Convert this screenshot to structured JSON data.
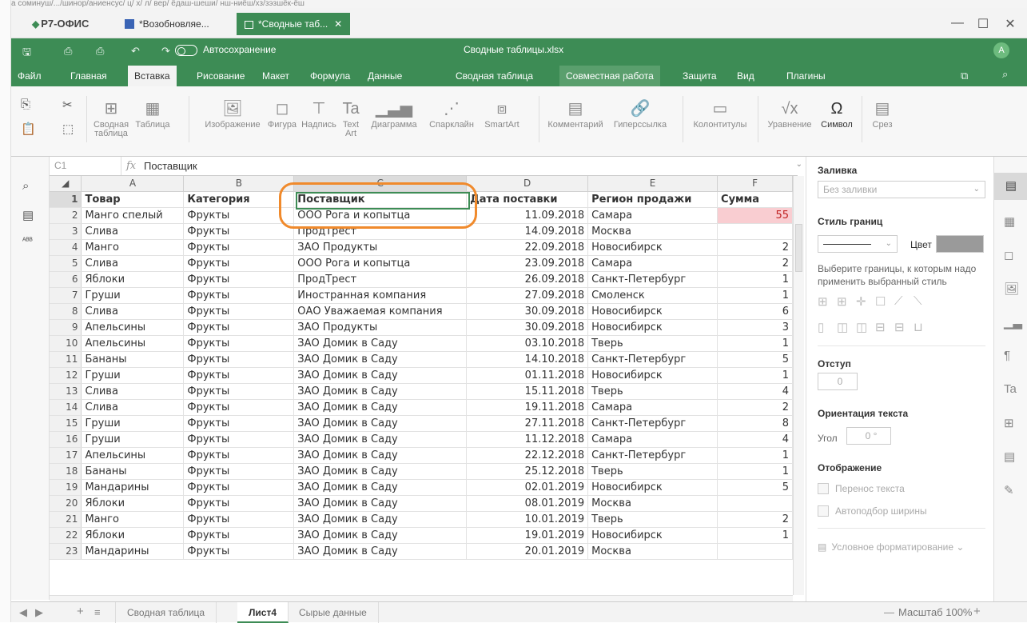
{
  "app": {
    "brand": "Р7-ОФИС",
    "tabs": [
      {
        "label": "*Возобновляе...",
        "active": false
      },
      {
        "label": "*Сводные таб...",
        "active": true
      }
    ],
    "url_strip": "а соминуш/.../шинор/аниенсус/ ц/ х/ л/ вер/ ёдаш-шеши/ нш-ниёш/хз/зэзшёк-ёш"
  },
  "header": {
    "autosave_label": "Автосохранение",
    "filename": "Сводные таблицы.xlsx",
    "avatar_initial": "A",
    "menu": [
      "Файл",
      "Главная",
      "Вставка",
      "Рисование",
      "Макет",
      "Формула",
      "Данные",
      "Сводная таблица",
      "Совместная работа",
      "Защита",
      "Вид",
      "Плагины"
    ],
    "active_menu": "Вставка",
    "highlight_menu": "Совместная работа"
  },
  "toolbar": {
    "pivot_label": "Сводная\nтаблица",
    "table_label": "Таблица",
    "image_label": "Изображение",
    "shape_label": "Фигура",
    "textbox_label": "Надпись",
    "textart_label": "Text\nArt",
    "chart_label": "Диаграмма",
    "sparkline_label": "Спарклайн",
    "smartart_label": "SmartArt",
    "comment_label": "Комментарий",
    "hyperlink_label": "Гиперссылка",
    "headerfooter_label": "Колонтитулы",
    "equation_label": "Уравнение",
    "symbol_label": "Символ",
    "slicer_label": "Срез"
  },
  "formula_bar": {
    "cell_ref": "C1",
    "fx": "fx",
    "value": "Поставщик"
  },
  "grid": {
    "columns": [
      "A",
      "B",
      "C",
      "D",
      "E",
      "F"
    ],
    "selected_column": "C",
    "header_row": [
      "Товар",
      "Категория",
      "Поставщик",
      "Дата поставки",
      "Регион продажи",
      "Сумма"
    ],
    "rows": [
      [
        "2",
        "Манго спелый",
        "Фрукты",
        "ООО Рога и копытца",
        "11.09.2018",
        "Самара",
        "55"
      ],
      [
        "3",
        "Слива",
        "Фрукты",
        "ПродТрест",
        "14.09.2018",
        "Москва",
        ""
      ],
      [
        "4",
        "Манго",
        "Фрукты",
        "ЗАО Продукты",
        "22.09.2018",
        "Новосибирск",
        "2"
      ],
      [
        "5",
        "Слива",
        "Фрукты",
        "ООО Рога и копытца",
        "23.09.2018",
        "Самара",
        "2"
      ],
      [
        "6",
        "Яблоки",
        "Фрукты",
        "ПродТрест",
        "26.09.2018",
        "Санкт-Петербург",
        "1"
      ],
      [
        "7",
        "Груши",
        "Фрукты",
        "Иностранная компания",
        "27.09.2018",
        "Смоленск",
        "1"
      ],
      [
        "8",
        "Слива",
        "Фрукты",
        "ОАО Уважаемая компания",
        "30.09.2018",
        "Новосибирск",
        "6"
      ],
      [
        "9",
        "Апельсины",
        "Фрукты",
        "ЗАО Продукты",
        "30.09.2018",
        "Новосибирск",
        "3"
      ],
      [
        "10",
        "Апельсины",
        "Фрукты",
        "ЗАО Домик в Саду",
        "03.10.2018",
        "Тверь",
        "1"
      ],
      [
        "11",
        "Бананы",
        "Фрукты",
        "ЗАО Домик в Саду",
        "14.10.2018",
        "Санкт-Петербург",
        "5"
      ],
      [
        "12",
        "Груши",
        "Фрукты",
        "ЗАО Домик в Саду",
        "01.11.2018",
        "Новосибирск",
        "1"
      ],
      [
        "13",
        "Слива",
        "Фрукты",
        "ЗАО Домик в Саду",
        "15.11.2018",
        "Тверь",
        "4"
      ],
      [
        "14",
        "Слива",
        "Фрукты",
        "ЗАО Домик в Саду",
        "19.11.2018",
        "Самара",
        "2"
      ],
      [
        "15",
        "Груши",
        "Фрукты",
        "ЗАО Домик в Саду",
        "27.11.2018",
        "Санкт-Петербург",
        "8"
      ],
      [
        "16",
        "Груши",
        "Фрукты",
        "ЗАО Домик в Саду",
        "11.12.2018",
        "Самара",
        "4"
      ],
      [
        "17",
        "Апельсины",
        "Фрукты",
        "ЗАО Домик в Саду",
        "22.12.2018",
        "Санкт-Петербург",
        "1"
      ],
      [
        "18",
        "Бананы",
        "Фрукты",
        "ЗАО Домик в Саду",
        "25.12.2018",
        "Тверь",
        "1"
      ],
      [
        "19",
        "Мандарины",
        "Фрукты",
        "ЗАО Домик в Саду",
        "02.01.2019",
        "Новосибирск",
        "5"
      ],
      [
        "20",
        "Яблоки",
        "Фрукты",
        "ЗАО Домик в Саду",
        "08.01.2019",
        "Москва",
        ""
      ],
      [
        "21",
        "Манго",
        "Фрукты",
        "ЗАО Домик в Саду",
        "10.01.2019",
        "Тверь",
        "2"
      ],
      [
        "22",
        "Яблоки",
        "Фрукты",
        "ЗАО Домик в Саду",
        "19.01.2019",
        "Новосибирск",
        "1"
      ],
      [
        "23",
        "Мандарины",
        "Фрукты",
        "ЗАО Домик в Саду",
        "20.01.2019",
        "Москва",
        ""
      ]
    ]
  },
  "right_panel": {
    "fill_title": "Заливка",
    "fill_value": "Без заливки",
    "border_style_title": "Стиль границ",
    "color_label": "Цвет",
    "border_hint": "Выберите границы, к которым надо применить выбранный стиль",
    "indent_title": "Отступ",
    "indent_value": "0",
    "orientation_title": "Ориентация текста",
    "angle_label": "Угол",
    "angle_value": "0 °",
    "display_title": "Отображение",
    "wrap_label": "Перенос текста",
    "autofit_label": "Автоподбор ширины",
    "cond_format_label": "Условное форматирование"
  },
  "status": {
    "sheets": [
      "Сводная таблица",
      "Лист4",
      "Сырые данные"
    ],
    "active_sheet": "Лист4",
    "zoom_label": "Масштаб 100%"
  },
  "colors": {
    "accent": "#3d8c55",
    "annotation": "#f08a2c",
    "highlight_cell": "#f9cdd1"
  }
}
